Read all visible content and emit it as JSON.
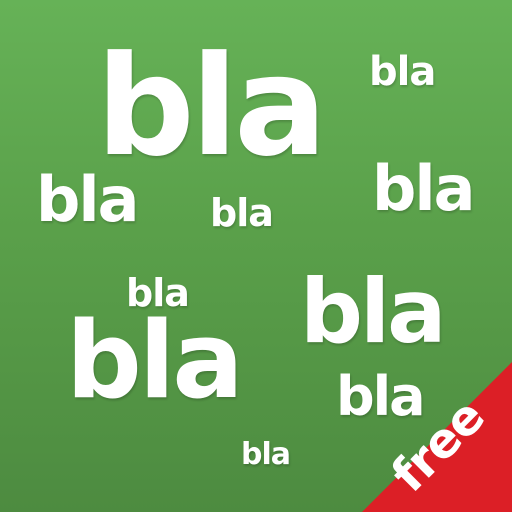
{
  "app_icon": {
    "words": [
      "bla",
      "bla",
      "bla",
      "bla",
      "bla",
      "bla",
      "bla",
      "bla",
      "bla",
      "bla"
    ],
    "badge": "free",
    "colors": {
      "background_top": "#66b257",
      "background_bottom": "#4d8b40",
      "text": "#ffffff",
      "badge": "#dc1f26"
    }
  }
}
